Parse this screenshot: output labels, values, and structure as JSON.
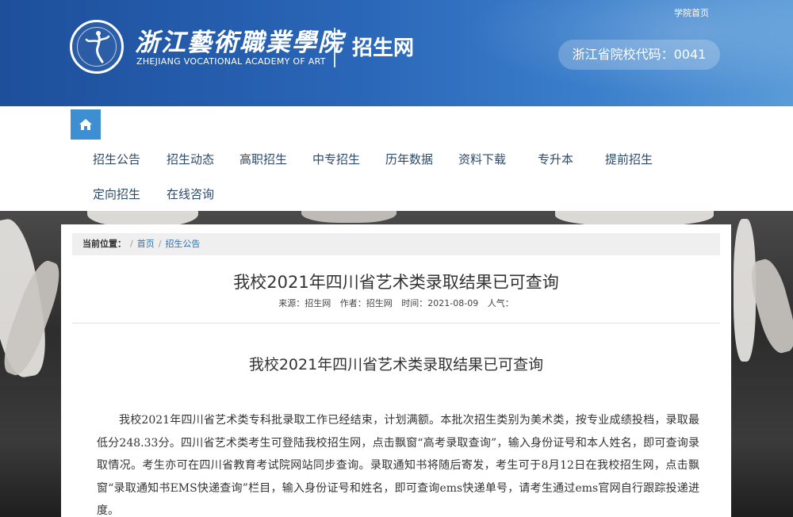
{
  "header": {
    "top_link": "学院首页",
    "logo_cn": "浙江藝術職業學院",
    "logo_en": "ZHEJIANG VOCATIONAL ACADEMY OF ART",
    "site_name": "招生网",
    "code_badge": "浙江省院校代码：0041"
  },
  "nav": {
    "home_icon": "home-icon",
    "items": [
      "招生公告",
      "招生动态",
      "高职招生",
      "中专招生",
      "历年数据",
      "资料下载",
      "专升本",
      "提前招生",
      "定向招生",
      "在线咨询"
    ]
  },
  "breadcrumb": {
    "label": "当前位置：",
    "sep": "/",
    "items": [
      "首页",
      "招生公告"
    ]
  },
  "article": {
    "title": "我校2021年四川省艺术类录取结果已可查询",
    "meta_source": "来源：招生网",
    "meta_author": "作者：招生网",
    "meta_time": "时间：2021-08-09",
    "meta_views": "人气：",
    "subtitle": "我校2021年四川省艺术类录取结果已可查询",
    "body": "我校2021年四川省艺术类专科批录取工作已经结束，计划满额。本批次招生类别为美术类，按专业成绩投档，录取最低分248.33分。四川省艺术类考生可登陆我校招生网，点击飘窗“高考录取查询”，输入身份证号和本人姓名，即可查询录取情况。考生亦可在四川省教育考试院网站同步查询。录取通知书将随后寄发，考生可于8月12日在我校招生网，点击飘窗“录取通知书EMS快递查询”栏目，输入身份证号和姓名，即可查询ems快递单号，请考生通过ems官网自行跟踪投递进度。"
  },
  "colors": {
    "header_blue": "#2a66b8",
    "home_button": "#3d8fd1",
    "link": "#2c6db3"
  }
}
